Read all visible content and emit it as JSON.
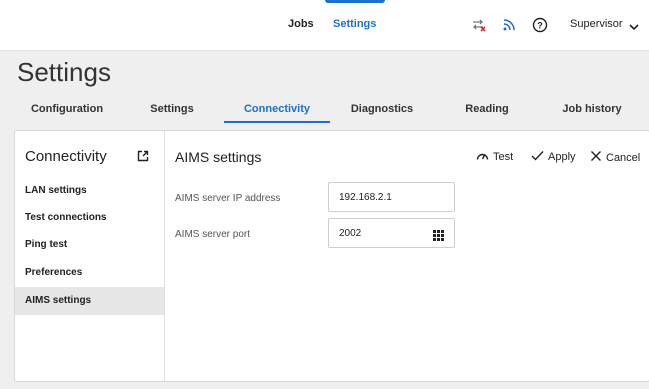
{
  "nav": {
    "jobs": "Jobs",
    "settings": "Settings",
    "user": "Supervisor"
  },
  "icons": {
    "transfer": "transfer-error-icon",
    "signal": "signal-icon",
    "help": "help-icon",
    "chevron": "chevron-down-icon"
  },
  "page": {
    "title": "Settings"
  },
  "tabs": [
    {
      "label": "Configuration"
    },
    {
      "label": "Settings"
    },
    {
      "label": "Connectivity"
    },
    {
      "label": "Diagnostics"
    },
    {
      "label": "Reading"
    },
    {
      "label": "Job history"
    }
  ],
  "sidebar": {
    "title": "Connectivity",
    "items": [
      {
        "label": "LAN settings"
      },
      {
        "label": "Test connections"
      },
      {
        "label": "Ping test"
      },
      {
        "label": "Preferences"
      },
      {
        "label": "AIMS settings"
      }
    ]
  },
  "main": {
    "title": "AIMS settings",
    "actions": {
      "test": "Test",
      "apply": "Apply",
      "cancel": "Cancel"
    },
    "fields": [
      {
        "label": "AIMS server IP address",
        "value": "192.168.2.1"
      },
      {
        "label": "AIMS server port",
        "value": "2002"
      }
    ]
  },
  "colors": {
    "accent": "#1d6fd0",
    "error": "#d9302c"
  }
}
